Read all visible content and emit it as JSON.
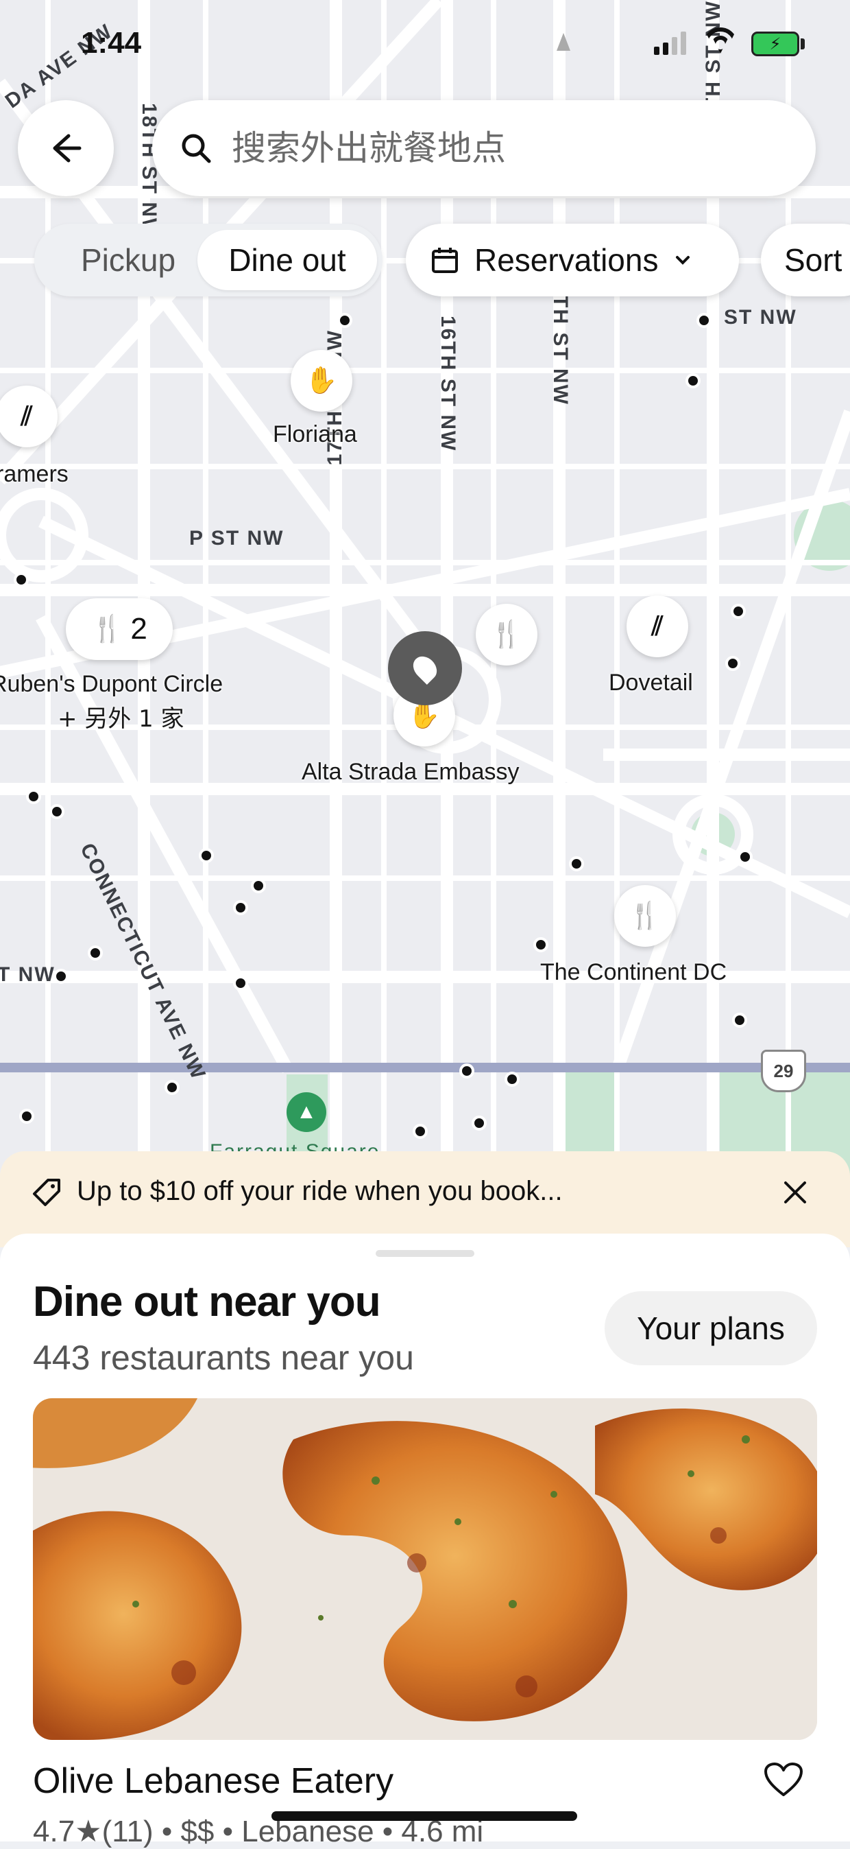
{
  "status_bar": {
    "time": "1:44"
  },
  "search": {
    "placeholder": "搜索外出就餐地点"
  },
  "mode_toggle": {
    "options": [
      "Pickup",
      "Dine out"
    ],
    "selected": "Dine out"
  },
  "filters": {
    "reservations": "Reservations",
    "sort": "Sort"
  },
  "map": {
    "streets": [
      "DA AVE NW",
      "18TH ST NW",
      "17TH ST NW",
      "16TH ST NW",
      "TH ST NW",
      "TH ST NW",
      "ST NW",
      "P ST NW",
      "CONNECTICUT AVE NW",
      "T NW",
      "Farragut Square"
    ],
    "route_shield": "29",
    "places": [
      {
        "name": "Floriana",
        "icon": "restaurant-logo-icon"
      },
      {
        "name": "ramers",
        "icon": "striped-logo-icon"
      },
      {
        "name": "Ruben's Dupont Circle",
        "extra": "+ 另外 1 家",
        "count": "2",
        "icon": "utensils-icon"
      },
      {
        "name": "Alta Strada Embassy",
        "icon": "restaurant-logo-icon"
      },
      {
        "name": "Dovetail",
        "icon": "striped-logo-icon"
      },
      {
        "name": "The Continent DC",
        "icon": "utensils-icon"
      }
    ]
  },
  "promo": {
    "text": "Up to $10 off your ride when you book..."
  },
  "sheet": {
    "title": "Dine out near you",
    "subtitle": "443 restaurants near you",
    "your_plans": "Your plans",
    "restaurant": {
      "name": "Olive Lebanese Eatery",
      "rating": "4.7",
      "reviews": "(11)",
      "price": "$$",
      "cuisine": "Lebanese",
      "distance": "4.6 mi",
      "meta_line": "4.7★(11) • $$ • Lebanese • 4.6 mi"
    }
  },
  "colors": {
    "map_bg": "#ecedf1",
    "road": "#ffffff",
    "park": "#c9e6d3",
    "promo_bg": "#faf0df",
    "battery": "#34c759"
  }
}
